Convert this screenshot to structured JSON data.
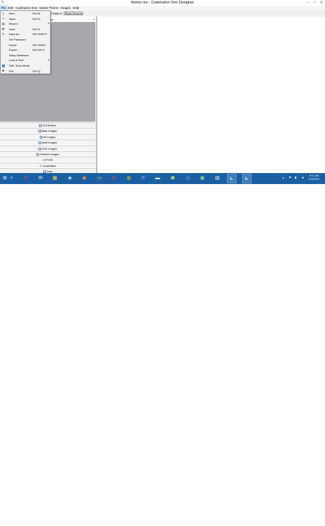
{
  "window": {
    "title": "theme.res - Codename One Designer",
    "controls": [
      "–",
      "□",
      "✕"
    ]
  },
  "menubar": {
    "items": [
      "File",
      "Edit",
      "Codename One",
      "Native Theme",
      "Images",
      "Help"
    ]
  },
  "toolbar": {
    "platform_label": "Platform:",
    "platform_value": "[Base Resource]"
  },
  "tree": {
    "header_col": "es"
  },
  "nav": {
    "items": [
      "GUI Builder",
      "Main Images",
      "All Images",
      "Multi Images",
      "SVG Images",
      "Timeline Images",
      "Fonts",
      "Localization",
      "Data"
    ]
  },
  "file_menu": {
    "items": [
      {
        "label": "New",
        "shortcut": "Ctrl+N",
        "icon": "new-file-icon"
      },
      {
        "label": "Open",
        "shortcut": "Ctrl+O",
        "icon": "open-folder-icon"
      },
      {
        "label": "Recent",
        "shortcut": "",
        "icon": "recent-icon",
        "submenu": true
      },
      {
        "label": "Save",
        "shortcut": "Ctrl+S",
        "icon": "save-icon"
      },
      {
        "label": "Save As...",
        "shortcut": "Ctrl+Shift+S",
        "icon": "save-as-icon"
      },
      {
        "label": "Set Password",
        "shortcut": "",
        "icon": ""
      },
      {
        "label": "Import",
        "shortcut": "Ctrl+Shift+I",
        "icon": ""
      },
      {
        "label": "Export...",
        "shortcut": "Ctrl+Alt+X",
        "icon": ""
      },
      {
        "label": "Setup Netbeans",
        "shortcut": "",
        "icon": ""
      },
      {
        "label": "Look & Feel",
        "shortcut": "",
        "icon": "",
        "submenu": true
      },
      {
        "label": "XML Team Mode",
        "shortcut": "",
        "icon": "checkbox-checked-icon",
        "checked": true
      },
      {
        "label": "Exit",
        "shortcut": "Ctrl+Q",
        "icon": "exit-icon"
      }
    ]
  },
  "taskbar": {
    "clock_time": "9:01 AM",
    "clock_date": "1/22/2017",
    "apps": [
      "start-icon",
      "ie-icon",
      "power-icon",
      "chat-icon",
      "rainbow-app-icon",
      "cube-icon",
      "firefox-icon",
      "file-explorer-icon",
      "opera-icon",
      "chrome-icon",
      "viber-icon",
      "terminal-icon",
      "android-icon",
      "virtualbox-icon",
      "image-viewer-icon",
      "network-computer-icon",
      "codename-one-icon",
      "codename-one-designer-icon"
    ]
  },
  "colors": {
    "taskbar": "#1a5fa3",
    "tree_area": "#a8a8ac",
    "menu_highlight": "#cce8ff"
  }
}
